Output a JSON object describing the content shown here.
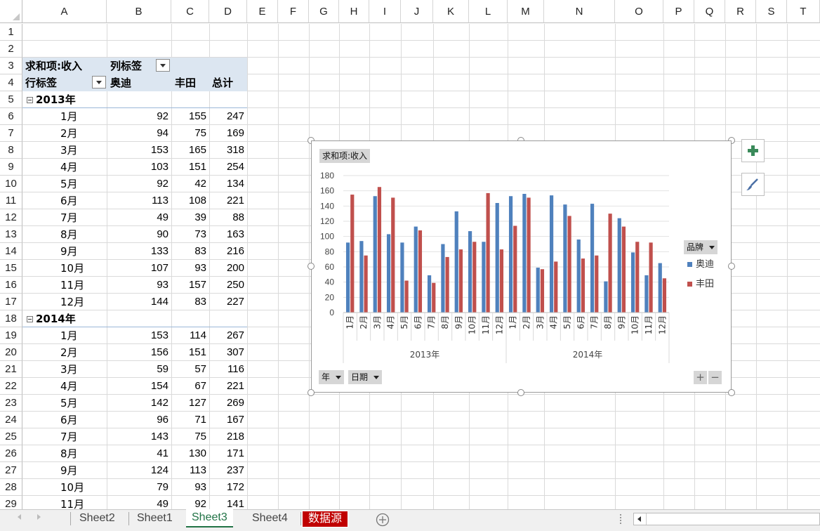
{
  "columns": [
    "A",
    "B",
    "C",
    "D",
    "E",
    "F",
    "G",
    "H",
    "I",
    "J",
    "K",
    "L",
    "M",
    "N",
    "O",
    "P",
    "Q",
    "R",
    "S",
    "T"
  ],
  "rows": [
    "1",
    "2",
    "3",
    "4",
    "5",
    "6",
    "7",
    "8",
    "9",
    "10",
    "11",
    "12",
    "13",
    "14",
    "15",
    "16",
    "17",
    "18",
    "19",
    "20",
    "21",
    "22",
    "23",
    "24",
    "25",
    "26",
    "27",
    "28",
    "29"
  ],
  "pivot": {
    "value_field": "求和项:收入",
    "col_label": "列标签",
    "row_label": "行标签",
    "brands": [
      "奥迪",
      "丰田"
    ],
    "total": "总计",
    "groups": [
      {
        "year": "2013年",
        "months": [
          {
            "m": "1月",
            "a": "92",
            "b": "155",
            "t": "247"
          },
          {
            "m": "2月",
            "a": "94",
            "b": "75",
            "t": "169"
          },
          {
            "m": "3月",
            "a": "153",
            "b": "165",
            "t": "318"
          },
          {
            "m": "4月",
            "a": "103",
            "b": "151",
            "t": "254"
          },
          {
            "m": "5月",
            "a": "92",
            "b": "42",
            "t": "134"
          },
          {
            "m": "6月",
            "a": "113",
            "b": "108",
            "t": "221"
          },
          {
            "m": "7月",
            "a": "49",
            "b": "39",
            "t": "88"
          },
          {
            "m": "8月",
            "a": "90",
            "b": "73",
            "t": "163"
          },
          {
            "m": "9月",
            "a": "133",
            "b": "83",
            "t": "216"
          },
          {
            "m": "10月",
            "a": "107",
            "b": "93",
            "t": "200"
          },
          {
            "m": "11月",
            "a": "93",
            "b": "157",
            "t": "250"
          },
          {
            "m": "12月",
            "a": "144",
            "b": "83",
            "t": "227"
          }
        ]
      },
      {
        "year": "2014年",
        "months": [
          {
            "m": "1月",
            "a": "153",
            "b": "114",
            "t": "267"
          },
          {
            "m": "2月",
            "a": "156",
            "b": "151",
            "t": "307"
          },
          {
            "m": "3月",
            "a": "59",
            "b": "57",
            "t": "116"
          },
          {
            "m": "4月",
            "a": "154",
            "b": "67",
            "t": "221"
          },
          {
            "m": "5月",
            "a": "142",
            "b": "127",
            "t": "269"
          },
          {
            "m": "6月",
            "a": "96",
            "b": "71",
            "t": "167"
          },
          {
            "m": "7月",
            "a": "143",
            "b": "75",
            "t": "218"
          },
          {
            "m": "8月",
            "a": "41",
            "b": "130",
            "t": "171"
          },
          {
            "m": "9月",
            "a": "124",
            "b": "113",
            "t": "237"
          },
          {
            "m": "10月",
            "a": "79",
            "b": "93",
            "t": "172"
          },
          {
            "m": "11月",
            "a": "49",
            "b": "92",
            "t": "141"
          }
        ]
      }
    ]
  },
  "chart_data": {
    "type": "bar",
    "value_field_button": "求和项:收入",
    "legend_title": "品牌",
    "legend_position": "right",
    "axis_buttons": [
      "年",
      "日期"
    ],
    "ylim": [
      0,
      180
    ],
    "yticks": [
      0,
      20,
      40,
      60,
      80,
      100,
      120,
      140,
      160,
      180
    ],
    "year_groups": [
      "2013年",
      "2014年"
    ],
    "categories": [
      "1月",
      "2月",
      "3月",
      "4月",
      "5月",
      "6月",
      "7月",
      "8月",
      "9月",
      "10月",
      "11月",
      "12月",
      "1月",
      "2月",
      "3月",
      "4月",
      "5月",
      "6月",
      "7月",
      "8月",
      "9月",
      "10月",
      "11月",
      "12月"
    ],
    "series": [
      {
        "name": "奥迪",
        "color": "#4f81bd",
        "values": [
          92,
          94,
          153,
          103,
          92,
          113,
          49,
          90,
          133,
          107,
          93,
          144,
          153,
          156,
          59,
          154,
          142,
          96,
          143,
          41,
          124,
          79,
          49,
          65
        ]
      },
      {
        "name": "丰田",
        "color": "#c0504d",
        "values": [
          155,
          75,
          165,
          151,
          42,
          108,
          39,
          73,
          83,
          93,
          157,
          83,
          114,
          151,
          57,
          67,
          127,
          71,
          75,
          130,
          113,
          93,
          92,
          45
        ]
      }
    ],
    "gridlines": true
  },
  "sheet_tabs": [
    "Sheet2",
    "Sheet1",
    "Sheet3",
    "Sheet4",
    "数据源"
  ],
  "active_tab": "Sheet3",
  "colors": {
    "accent": "#217346",
    "pivot_header": "#dce6f1",
    "red_tab": "#c00000"
  }
}
